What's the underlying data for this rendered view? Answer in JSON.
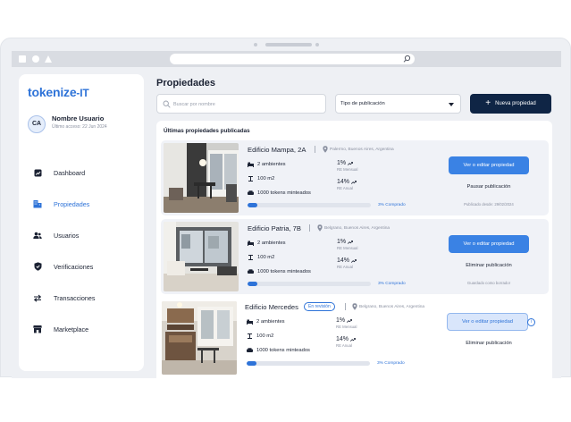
{
  "sidebar": {
    "logo": "tokenize",
    "logo_suffix": "-IT",
    "user": {
      "initials": "CA",
      "name": "Nombre Usuario",
      "last_access": "Último acceso: 22 Jun 2024"
    },
    "items": [
      {
        "label": "Dashboard",
        "icon": "chart-icon"
      },
      {
        "label": "Propiedades",
        "icon": "building-icon",
        "active": true
      },
      {
        "label": "Usuarios",
        "icon": "users-icon"
      },
      {
        "label": "Verificaciones",
        "icon": "shield-icon"
      },
      {
        "label": "Transacciones",
        "icon": "transfer-icon"
      },
      {
        "label": "Marketplace",
        "icon": "store-icon"
      }
    ]
  },
  "main": {
    "title": "Propiedades",
    "search_placeholder": "Buscar por nombre",
    "publication_type_label": "Tipo de publicación",
    "new_property_label": "Nueva propiedad",
    "list_title": "Últimas propiedades publicadas"
  },
  "properties": [
    {
      "name": "Edificio Mampa, 2A",
      "location": "Palermo, Buenos Aires, Argentina",
      "rooms": "2 ambientes",
      "area": "100 m2",
      "tokens": "1000 tokens minteados",
      "re_monthly": "1%",
      "re_monthly_label": "RE Mensual",
      "re_annual": "14%",
      "re_annual_label": "RE Anual",
      "progress": 0.08,
      "progress_label": "3% Comprado",
      "primary_action": "Ver o editar propiedad",
      "secondary_action": "Pausar publicación",
      "note": "Publicado desde: 29/02/2024"
    },
    {
      "name": "Edificio Patria, 7B",
      "location": "Belgrano, Buenos Aires, Argentina",
      "rooms": "2 ambientes",
      "area": "100 m2",
      "tokens": "1000 tokens minteados",
      "re_monthly": "1%",
      "re_monthly_label": "RE Mensual",
      "re_annual": "14%",
      "re_annual_label": "RE Anual",
      "progress": 0.08,
      "progress_label": "3% Comprado",
      "primary_action": "Ver o editar propiedad",
      "secondary_action": "Eliminar publicación",
      "note": "Guardado como borrador"
    },
    {
      "name": "Edificio Mercedes",
      "badge": "En revisión",
      "location": "Belgrano, Buenos Aires, Argentina",
      "rooms": "2 ambientes",
      "area": "100 m2",
      "tokens": "1000 tokens minteados",
      "re_monthly": "1%",
      "re_monthly_label": "RE Mensual",
      "re_annual": "14%",
      "re_annual_label": "RE Anual",
      "progress": 0.08,
      "progress_label": "3% Comprado",
      "primary_action": "Ver o editar propiedad",
      "info_icon": "i",
      "secondary_action": "Eliminar publicación"
    }
  ],
  "colors": {
    "accent": "#2e73d8",
    "primary_button": "#0f2545",
    "background": "#eef0f4"
  }
}
